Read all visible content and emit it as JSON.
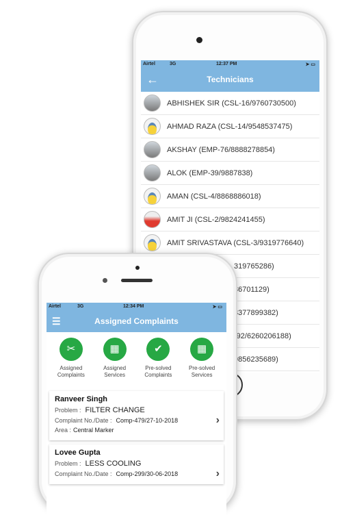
{
  "back_phone": {
    "status": {
      "carrier": "Airtel",
      "network": "3G",
      "time": "12:37 PM"
    },
    "header": {
      "title": "Technicians",
      "back_icon": "arrow-left-icon"
    },
    "technicians": [
      {
        "label": "ABHISHEK SIR (CSL-16/9760730500)",
        "avatar": "photo"
      },
      {
        "label": "AHMAD RAZA (CSL-14/9548537475)",
        "avatar": "cartoon"
      },
      {
        "label": "AKSHAY (EMP-76/8888278854)",
        "avatar": "photo"
      },
      {
        "label": "ALOK (EMP-39/9887838)",
        "avatar": "photo"
      },
      {
        "label": "AMAN (CSL-4/8868886018)",
        "avatar": "cartoon"
      },
      {
        "label": "AMIT JI (CSL-2/9824241455)",
        "avatar": "red"
      },
      {
        "label": "AMIT SRIVASTAVA (CSL-3/9319776640)",
        "avatar": "cartoon"
      },
      {
        "label": "319765286)",
        "avatar": ""
      },
      {
        "label": "86701129)",
        "avatar": ""
      },
      {
        "label": "8377899382)",
        "avatar": ""
      },
      {
        "label": "-92/6260206188)",
        "avatar": ""
      },
      {
        "label": "9856235689)",
        "avatar": ""
      }
    ]
  },
  "front_phone": {
    "status": {
      "carrier": "Airtel",
      "network": "3G",
      "time": "12:34 PM"
    },
    "header": {
      "title": "Assigned Complaints",
      "menu_icon": "hamburger-menu-icon"
    },
    "categories": [
      {
        "line1": "Assigned",
        "line2": "Complaints",
        "icon": "technician-tools-icon"
      },
      {
        "line1": "Assigned",
        "line2": "Services",
        "icon": "calendar-user-icon"
      },
      {
        "line1": "Pre-solved",
        "line2": "Complaints",
        "icon": "technician-check-icon"
      },
      {
        "line1": "Pre-solved",
        "line2": "Services",
        "icon": "calendar-check-icon"
      }
    ],
    "complaints": [
      {
        "name": "Ranveer Singh",
        "problem_label": "Problem :",
        "problem": "FILTER CHANGE",
        "no_label": "Complaint No./Date :",
        "no": "Comp-479/27-10-2018",
        "area_label": "Area :",
        "area": "Central Marker"
      },
      {
        "name": "Lovee Gupta",
        "problem_label": "Problem :",
        "problem": "LESS COOLING",
        "no_label": "Complaint No./Date :",
        "no": "Comp-299/30-06-2018"
      }
    ],
    "accent": "#27a844",
    "header_color": "#7fb6e0"
  }
}
